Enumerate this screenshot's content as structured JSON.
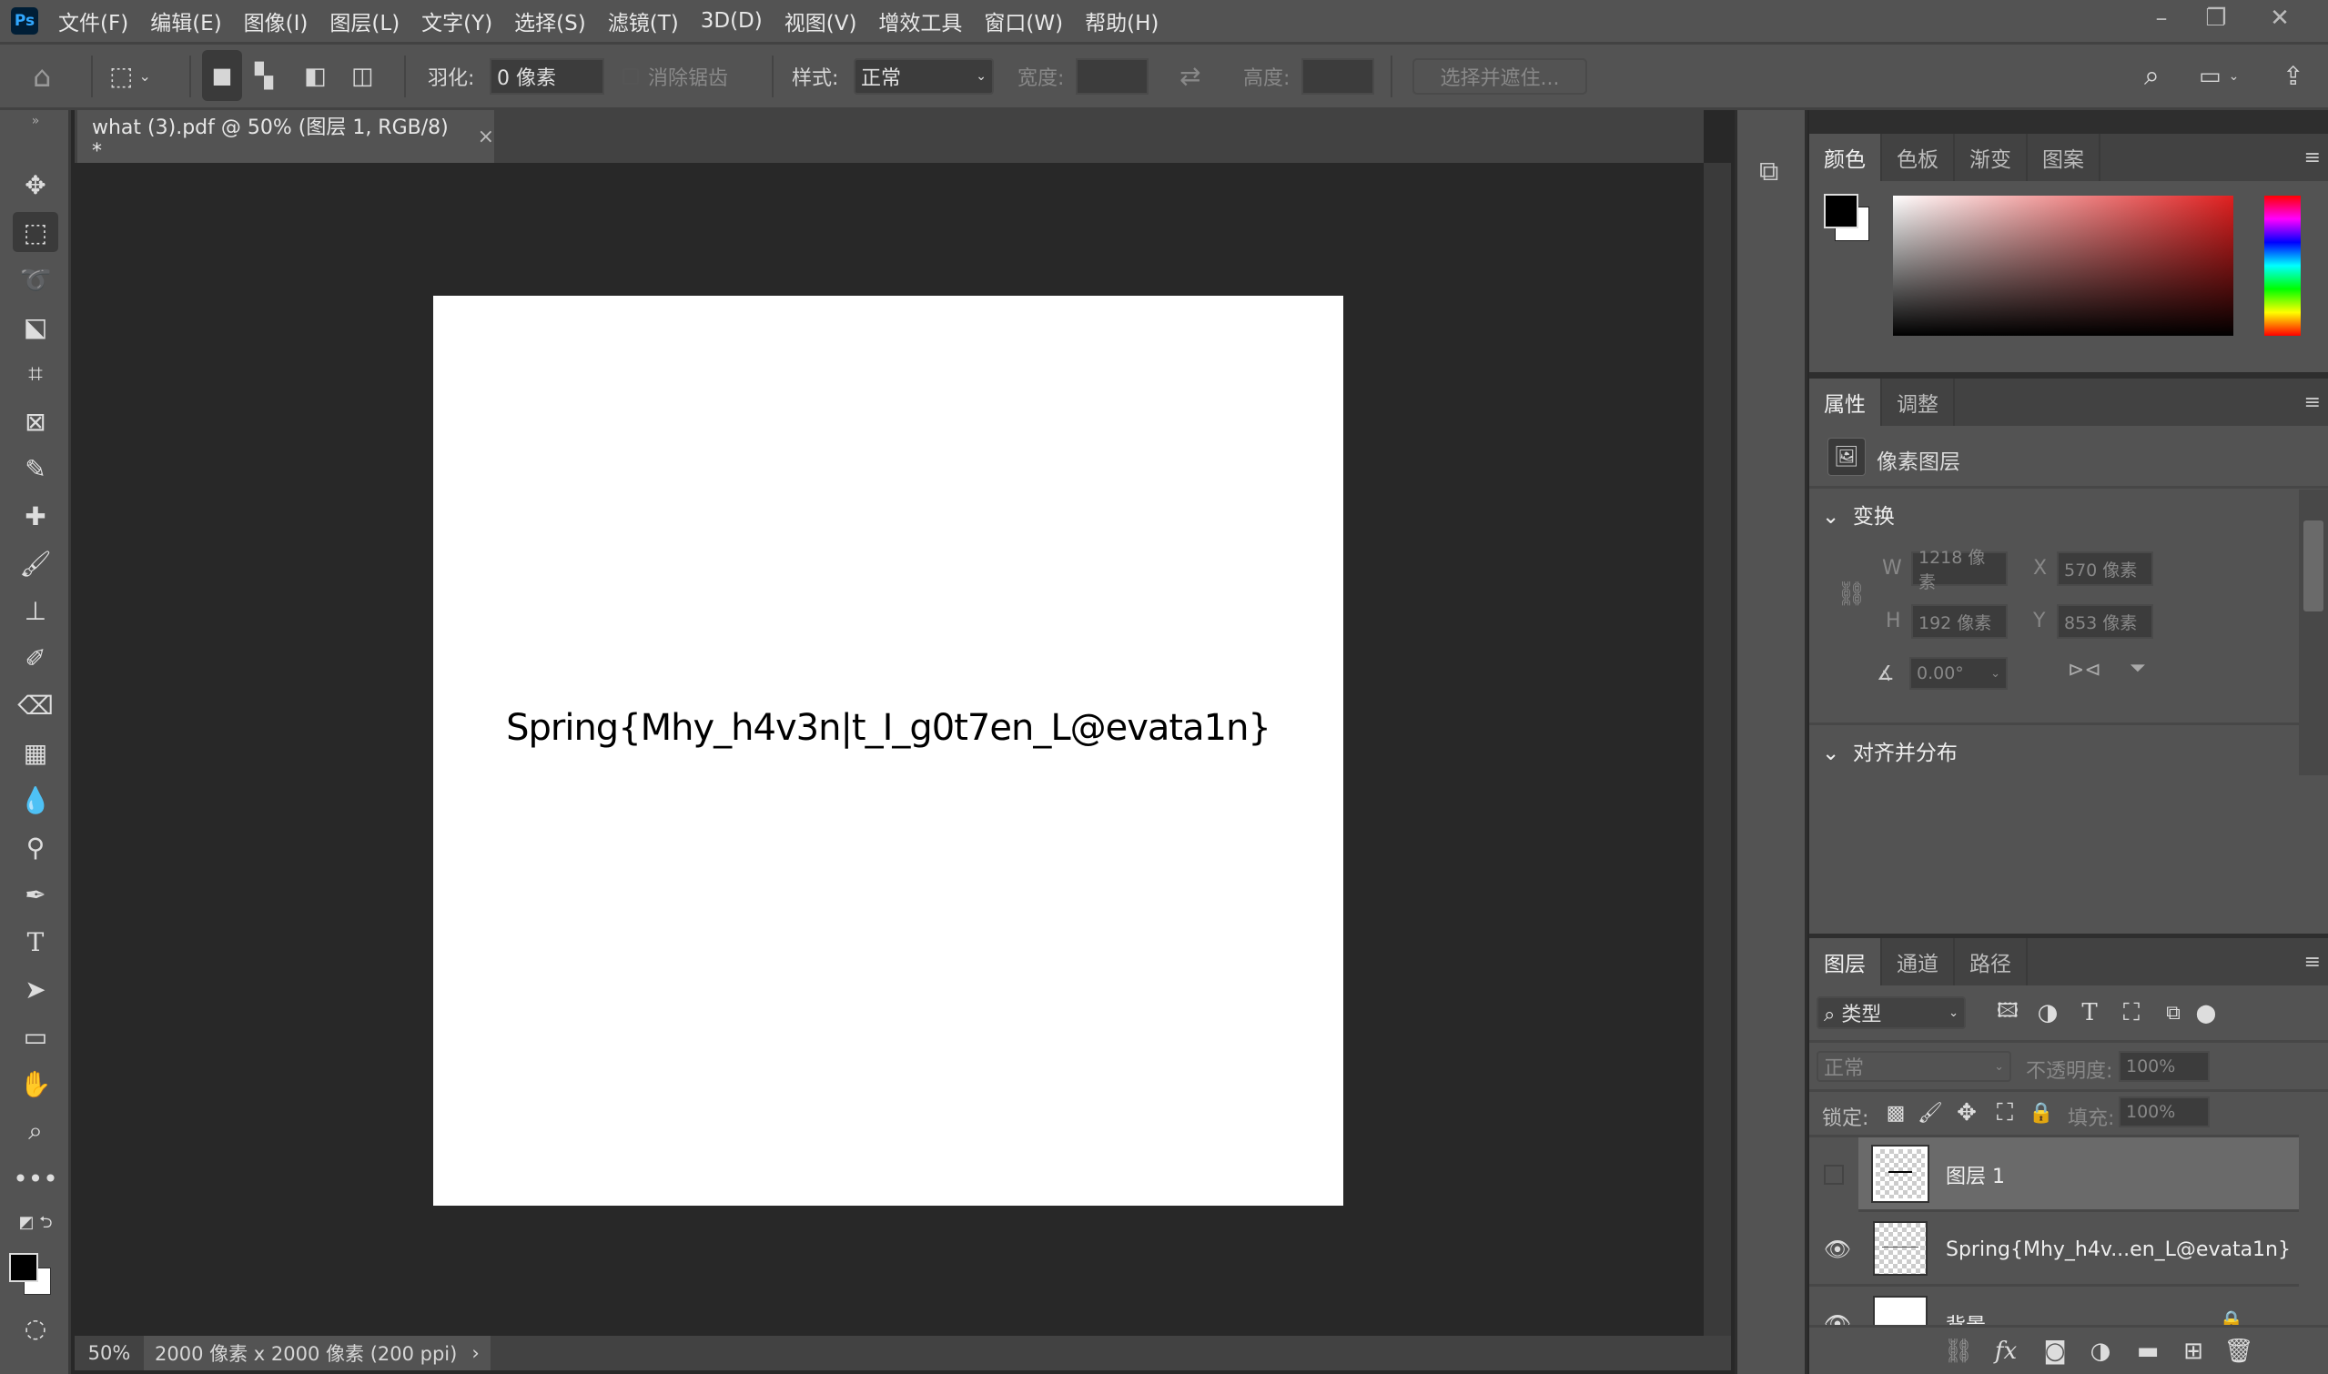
{
  "app": {
    "logo": "Ps"
  },
  "menu": [
    "文件(F)",
    "编辑(E)",
    "图像(I)",
    "图层(L)",
    "文字(Y)",
    "选择(S)",
    "滤镜(T)",
    "3D(D)",
    "视图(V)",
    "增效工具",
    "窗口(W)",
    "帮助(H)"
  ],
  "options": {
    "feather_label": "羽化:",
    "feather_value": "0 像素",
    "antialias_label": "消除锯齿",
    "style_label": "样式:",
    "style_value": "正常",
    "width_label": "宽度:",
    "height_label": "高度:",
    "select_mask_button": "选择并遮住..."
  },
  "document": {
    "tab_title": "what (3).pdf @ 50% (图层 1, RGB/8) *",
    "canvas_text": "Spring{Mhy_h4v3n|t_I_g0t7en_L@evata1n}",
    "zoom": "50%",
    "info": "2000 像素 x 2000 像素 (200 ppi)"
  },
  "color_panel": {
    "tabs": [
      "颜色",
      "色板",
      "渐变",
      "图案"
    ],
    "foreground": "#000000",
    "background": "#ffffff",
    "hue": "#e02020"
  },
  "properties": {
    "tabs": [
      "属性",
      "调整"
    ],
    "layer_type": "像素图层",
    "transform_title": "变换",
    "w_label": "W",
    "w_value": "1218 像素",
    "x_label": "X",
    "x_value": "570 像素",
    "h_label": "H",
    "h_value": "192 像素",
    "y_label": "Y",
    "y_value": "853 像素",
    "angle_value": "0.00°",
    "align_title": "对齐并分布"
  },
  "layers_panel": {
    "tabs": [
      "图层",
      "通道",
      "路径"
    ],
    "filter_value": "类型",
    "blend_mode": "正常",
    "opacity_label": "不透明度:",
    "opacity_value": "100%",
    "lock_label": "锁定:",
    "fill_label": "填充:",
    "fill_value": "100%",
    "layers": [
      {
        "name": "图层 1",
        "visible": false,
        "selected": true
      },
      {
        "name": "Spring{Mhy_h4v...en_L@evata1n}",
        "visible": true,
        "selected": false
      },
      {
        "name": "背景",
        "visible": true,
        "selected": false,
        "locked": true
      }
    ]
  }
}
